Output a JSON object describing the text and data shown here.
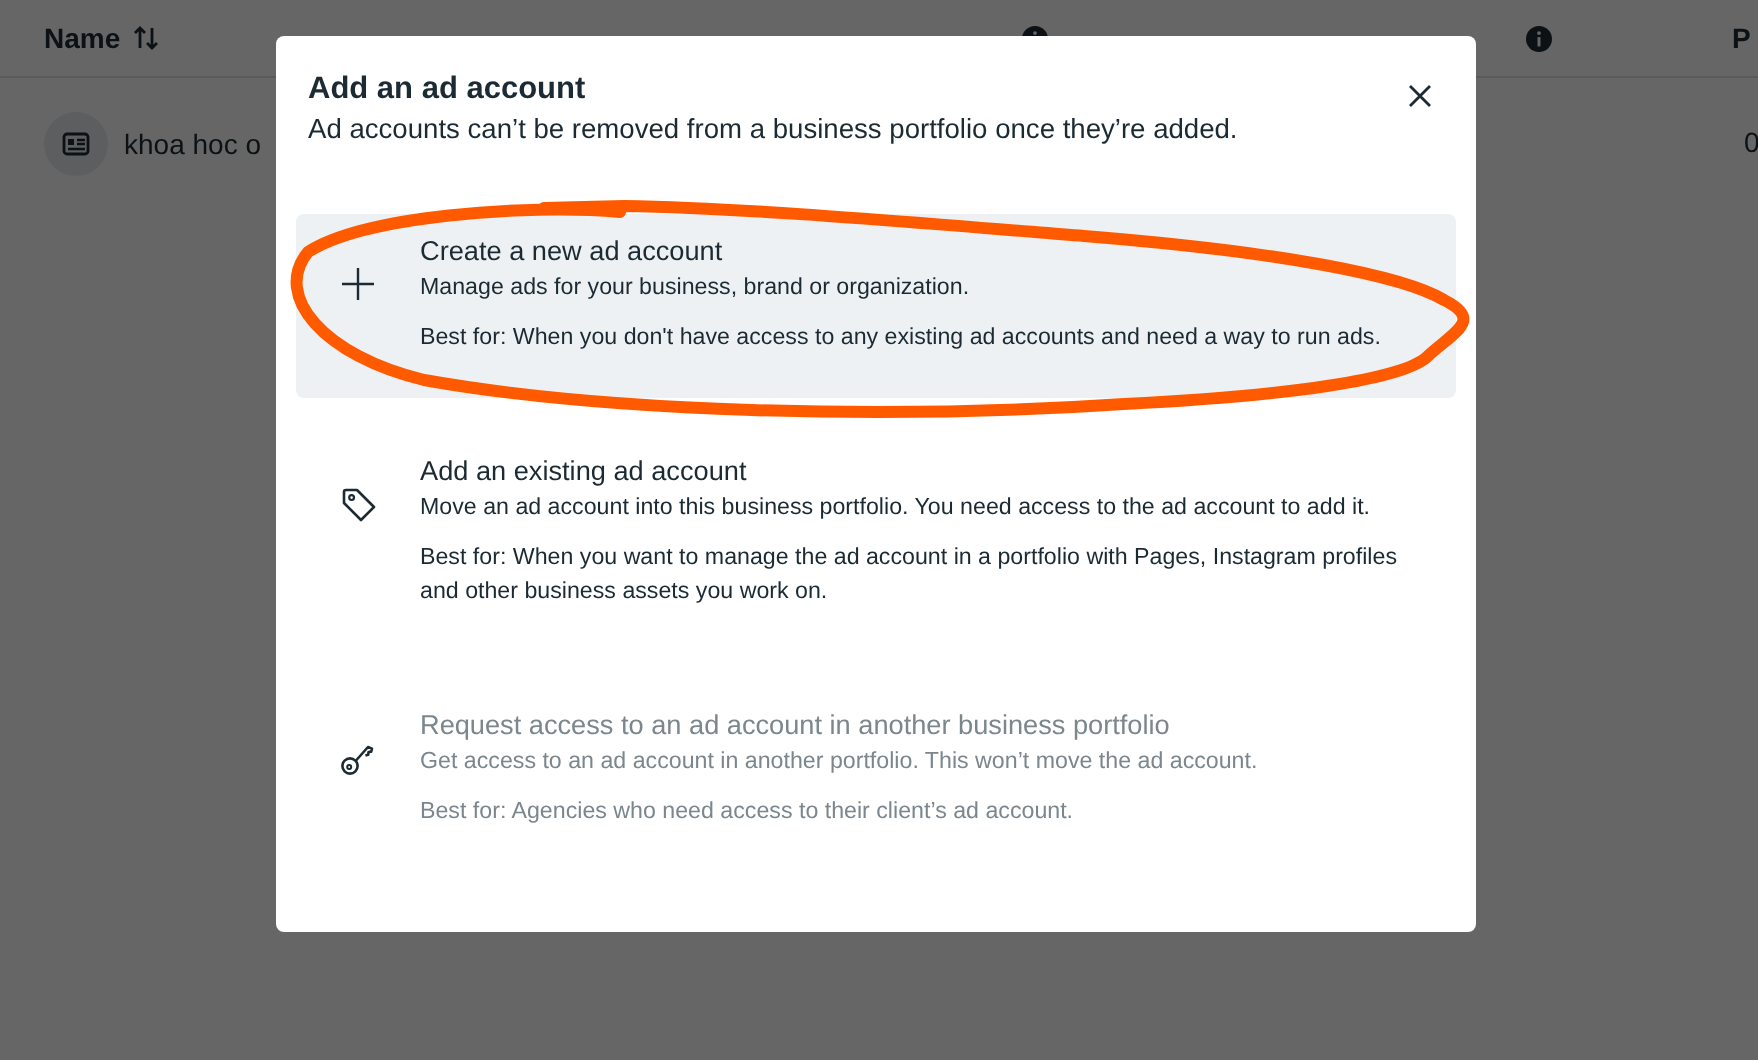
{
  "table": {
    "columns": [
      {
        "label": "Name",
        "kind": "sortable"
      },
      {
        "kind": "info"
      },
      {
        "kind": "info"
      },
      {
        "label": "P",
        "kind": "plain"
      }
    ],
    "rows": [
      {
        "name": "khoa hoc o",
        "column_4": "0"
      }
    ]
  },
  "dialog": {
    "title": "Add an ad account",
    "subtitle": "Ad accounts can’t be removed from a business portfolio once they’re added.",
    "options": [
      {
        "kind": "plus",
        "title": "Create a new ad account",
        "description": "Manage ads for your business, brand or organization.",
        "best_for": "Best for: When you don't have access to any existing ad accounts and need a way to run ads.",
        "selected": true,
        "disabled": false
      },
      {
        "kind": "tag",
        "title": "Add an existing ad account",
        "description": "Move an ad account into this business portfolio. You need access to the ad account to add it.",
        "best_for": "Best for: When you want to manage the ad account in a portfolio with Pages, Instagram profiles and other business assets you work on.",
        "selected": false,
        "disabled": false
      },
      {
        "kind": "key",
        "title": "Request access to an ad account in another business portfolio",
        "description": "Get access to an ad account in another portfolio. This won’t move the ad account.",
        "best_for": "Best for: Agencies who need access to their client’s ad account.",
        "selected": false,
        "disabled": true
      }
    ]
  }
}
